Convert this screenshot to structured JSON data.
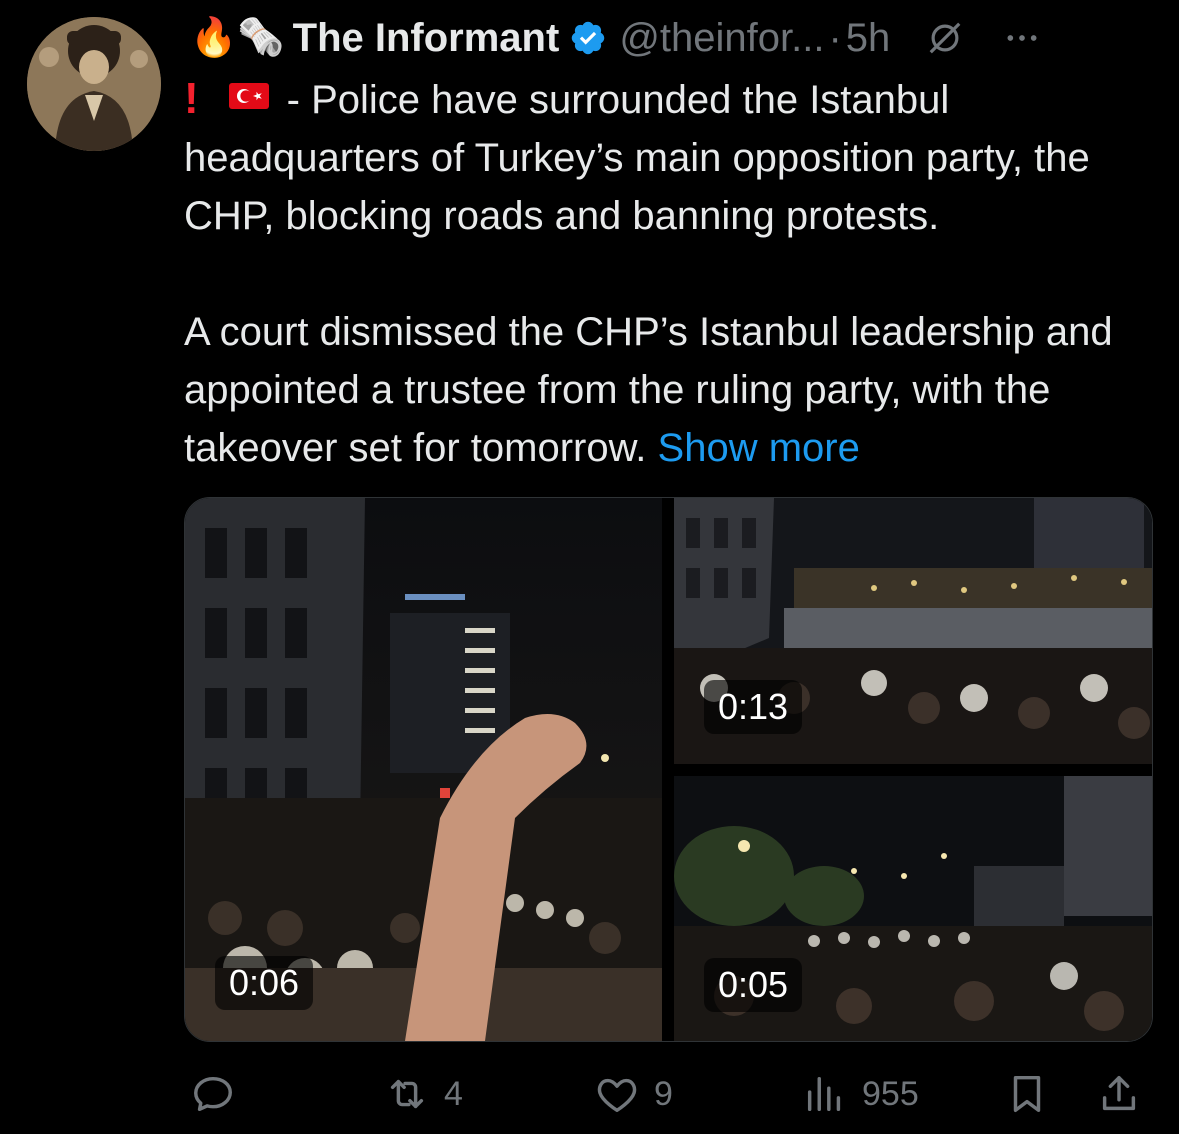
{
  "author": {
    "emojis": "🔥🗞️",
    "name": "The Informant",
    "handle": "@theinfor...",
    "separator": "·",
    "time": "5h"
  },
  "post": {
    "line_prefix_flag": "🇹🇷",
    "paragraph_1": "- Police have surrounded the Istanbul headquarters of Turkey’s main opposition party, the CHP, blocking roads and banning protests.",
    "paragraph_2": "A court dismissed the CHP’s Istanbul leadership and appointed a trustee from the ruling party, with the takeover set for tomorrow.",
    "show_more": "Show more"
  },
  "media": [
    {
      "duration": "0:06"
    },
    {
      "duration": "0:13"
    },
    {
      "duration": "0:05"
    }
  ],
  "actions": {
    "replies": "",
    "reposts": "4",
    "likes": "9",
    "views": "955"
  },
  "icons": {
    "verified": "verified-badge-icon",
    "grok": "grok-icon",
    "more": "more-icon",
    "reply": "reply-icon",
    "repost": "repost-icon",
    "like": "heart-icon",
    "views": "views-icon",
    "bookmark": "bookmark-icon",
    "share": "share-icon"
  },
  "colors": {
    "background": "#000000",
    "text": "#e7e9ea",
    "secondary": "#71767b",
    "link": "#1d9bf0",
    "verified": "#1d9bf0",
    "alert": "#f4212e"
  }
}
